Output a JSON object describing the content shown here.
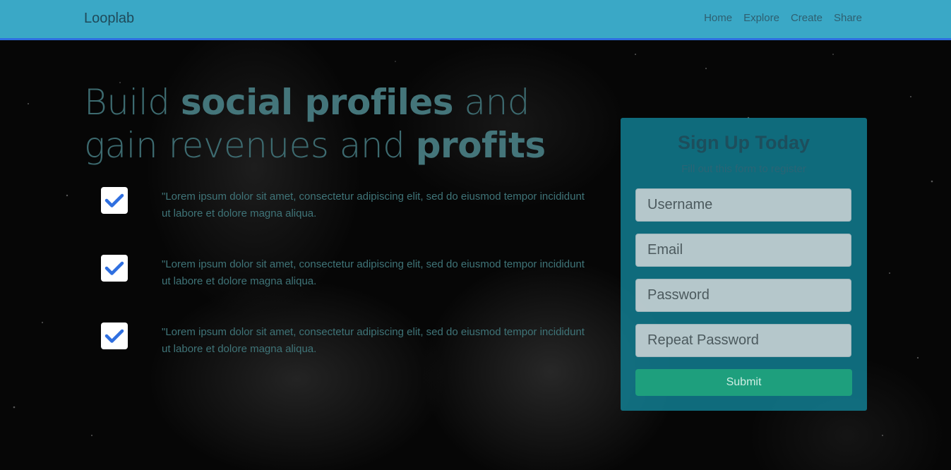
{
  "navbar": {
    "brand": "Looplab",
    "links": [
      "Home",
      "Explore",
      "Create",
      "Share"
    ]
  },
  "hero": {
    "headline_part1": "Build ",
    "headline_bold1": "social profiles",
    "headline_part2": " and gain revenues and ",
    "headline_bold2": "profits",
    "features": [
      "\"Lorem ipsum dolor sit amet, consectetur adipiscing elit, sed do eiusmod tempor incididunt ut labore et dolore magna aliqua.",
      "\"Lorem ipsum dolor sit amet, consectetur adipiscing elit, sed do eiusmod tempor incididunt ut labore et dolore magna aliqua.",
      "\"Lorem ipsum dolor sit amet, consectetur adipiscing elit, sed do eiusmod tempor incididunt ut labore et dolore magna aliqua."
    ]
  },
  "signup": {
    "title": "Sign Up Today",
    "subtitle": "Fill out this form to register",
    "username_placeholder": "Username",
    "email_placeholder": "Email",
    "password_placeholder": "Password",
    "repeat_password_placeholder": "Repeat Password",
    "submit_label": "Submit"
  },
  "colors": {
    "navbar": "#3aa8c6",
    "navbar_border": "#2f6fe0",
    "card": "#12889e",
    "submit": "#1e9f7d",
    "check": "#2f6fe0"
  },
  "icons": {
    "feature_check": "checkmark-icon"
  }
}
